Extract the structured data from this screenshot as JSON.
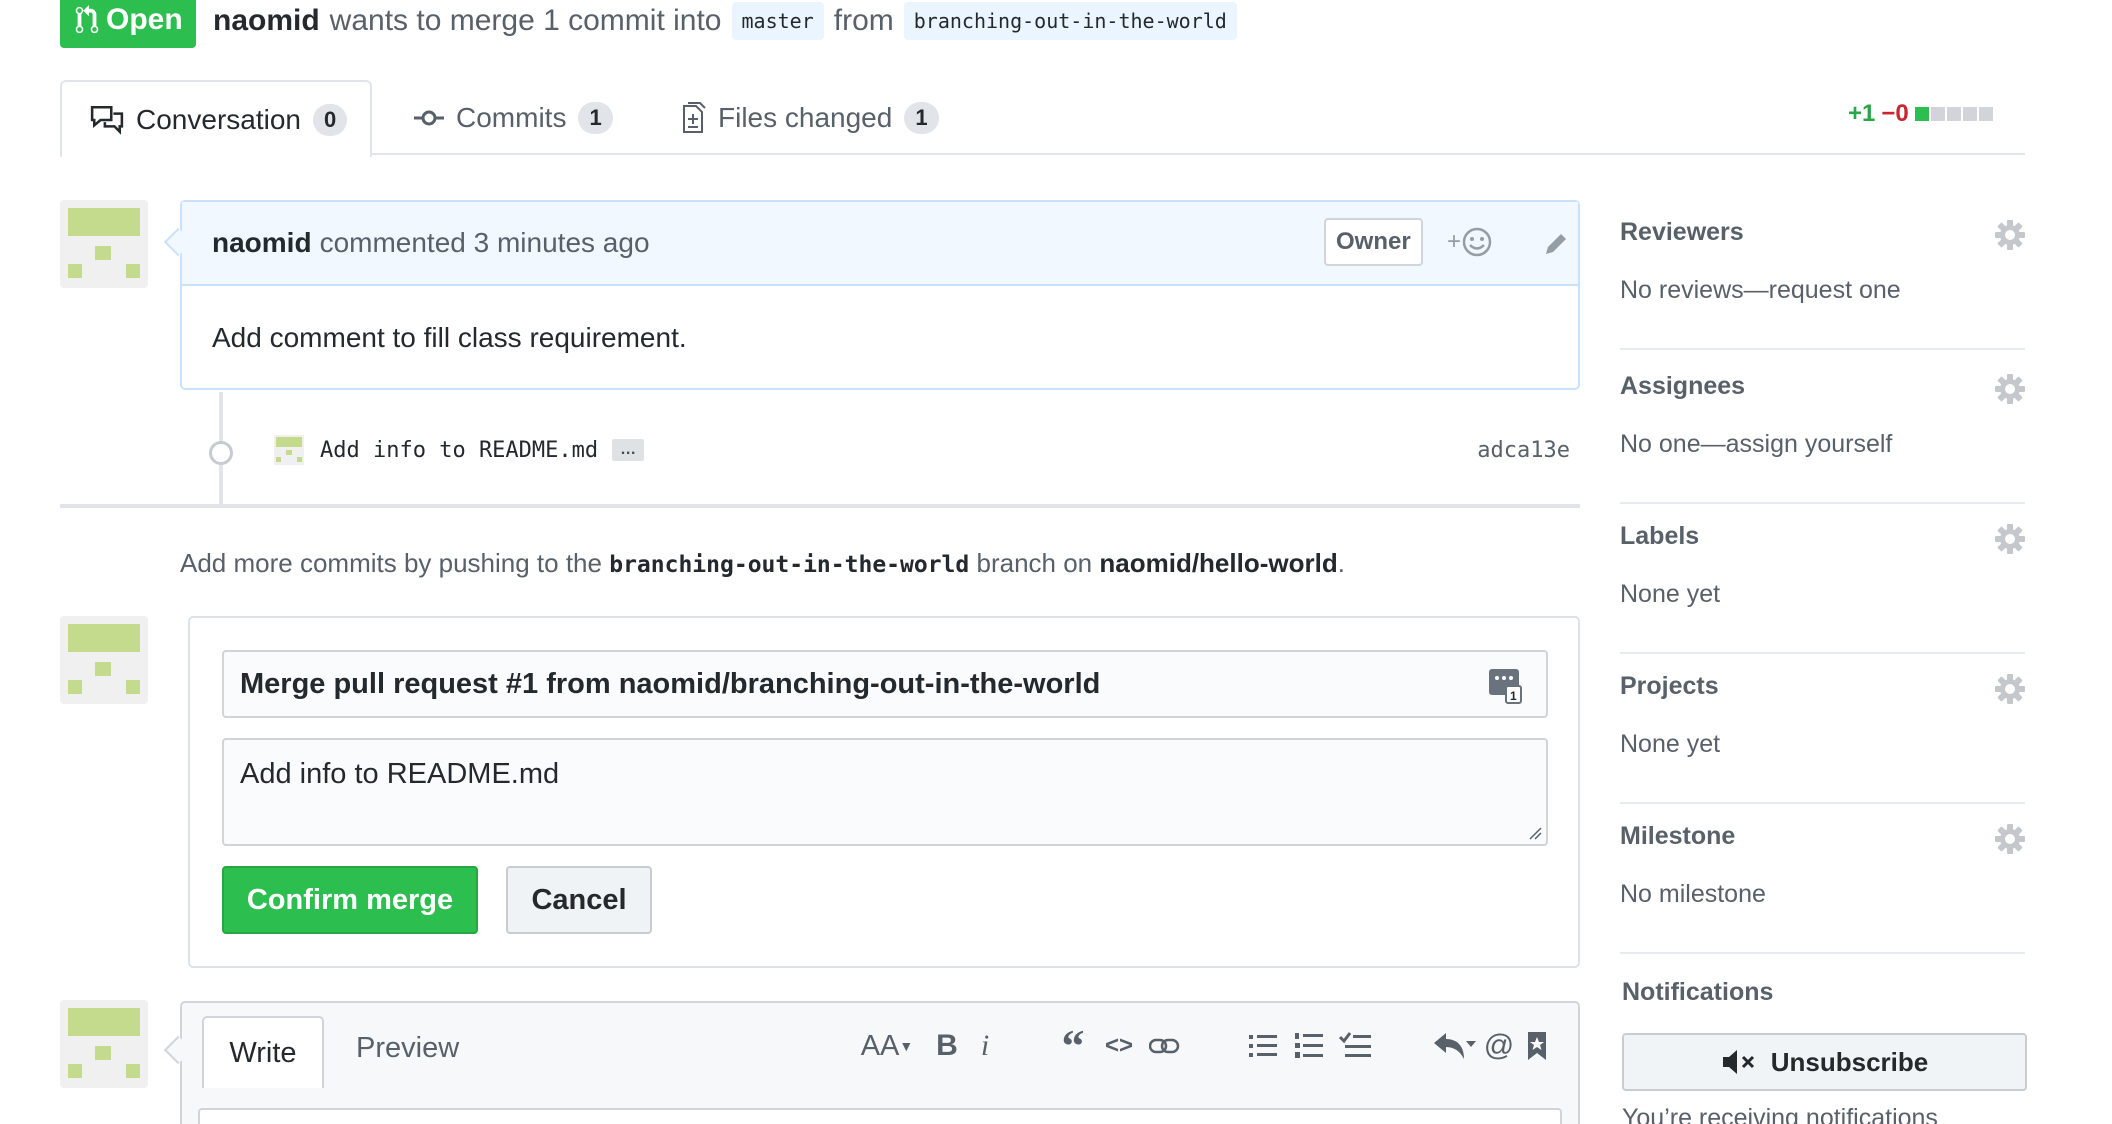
{
  "header": {
    "state_label": "Open",
    "author": "naomid",
    "merge_text_1": "wants to merge 1 commit into",
    "base_branch": "master",
    "merge_text_2": "from",
    "head_branch": "branching-out-in-the-world"
  },
  "tabs": [
    {
      "label": "Conversation",
      "count": "0",
      "icon": "comment-discussion-icon"
    },
    {
      "label": "Commits",
      "count": "1",
      "icon": "git-commit-icon"
    },
    {
      "label": "Files changed",
      "count": "1",
      "icon": "file-diff-icon"
    }
  ],
  "diffstat": {
    "additions": "+1",
    "deletions": "−0",
    "green_blocks": 1,
    "total_blocks": 5
  },
  "comment": {
    "author": "naomid",
    "action": "commented 3 minutes ago",
    "role_badge": "Owner",
    "reaction_label": "+",
    "body": "Add comment to fill class requirement."
  },
  "commit": {
    "message": "Add info to README.md",
    "ellipsis": "…",
    "sha": "adca13e"
  },
  "push_note": {
    "text_1": "Add more commits by pushing to the",
    "branch": "branching-out-in-the-world",
    "text_2": "branch on",
    "repo": "naomid/hello-world",
    "text_3": "."
  },
  "merge_form": {
    "title_value": "Merge pull request #1 from naomid/branching-out-in-the-world",
    "body_value": "Add info to README.md",
    "confirm_label": "Confirm merge",
    "cancel_label": "Cancel"
  },
  "editor": {
    "write_tab": "Write",
    "preview_tab": "Preview",
    "toolbar": [
      "text-size-icon",
      "bold-icon",
      "italic-icon",
      "quote-icon",
      "code-icon",
      "link-icon",
      "unordered-list-icon",
      "ordered-list-icon",
      "task-list-icon",
      "reply-icon",
      "mention-icon",
      "saved-reply-icon"
    ],
    "toolbar_glyphs": {
      "text_size": "AA",
      "bold": "B",
      "italic": "i",
      "quote": "“",
      "code": "<>",
      "mention": "@"
    }
  },
  "sidebar": [
    {
      "title": "Reviewers",
      "value": "No reviews—request one"
    },
    {
      "title": "Assignees",
      "value": "No one—assign yourself"
    },
    {
      "title": "Labels",
      "value": "None yet"
    },
    {
      "title": "Projects",
      "value": "None yet"
    },
    {
      "title": "Milestone",
      "value": "No milestone"
    }
  ],
  "notifications": {
    "title": "Notifications",
    "button_label": "Unsubscribe",
    "note": "You’re receiving notifications"
  },
  "colors": {
    "green": "#2cbe4e",
    "blue_border": "#c8e1ff",
    "header_blue": "#f1f8ff",
    "avatar_green": "#c4da8c"
  }
}
